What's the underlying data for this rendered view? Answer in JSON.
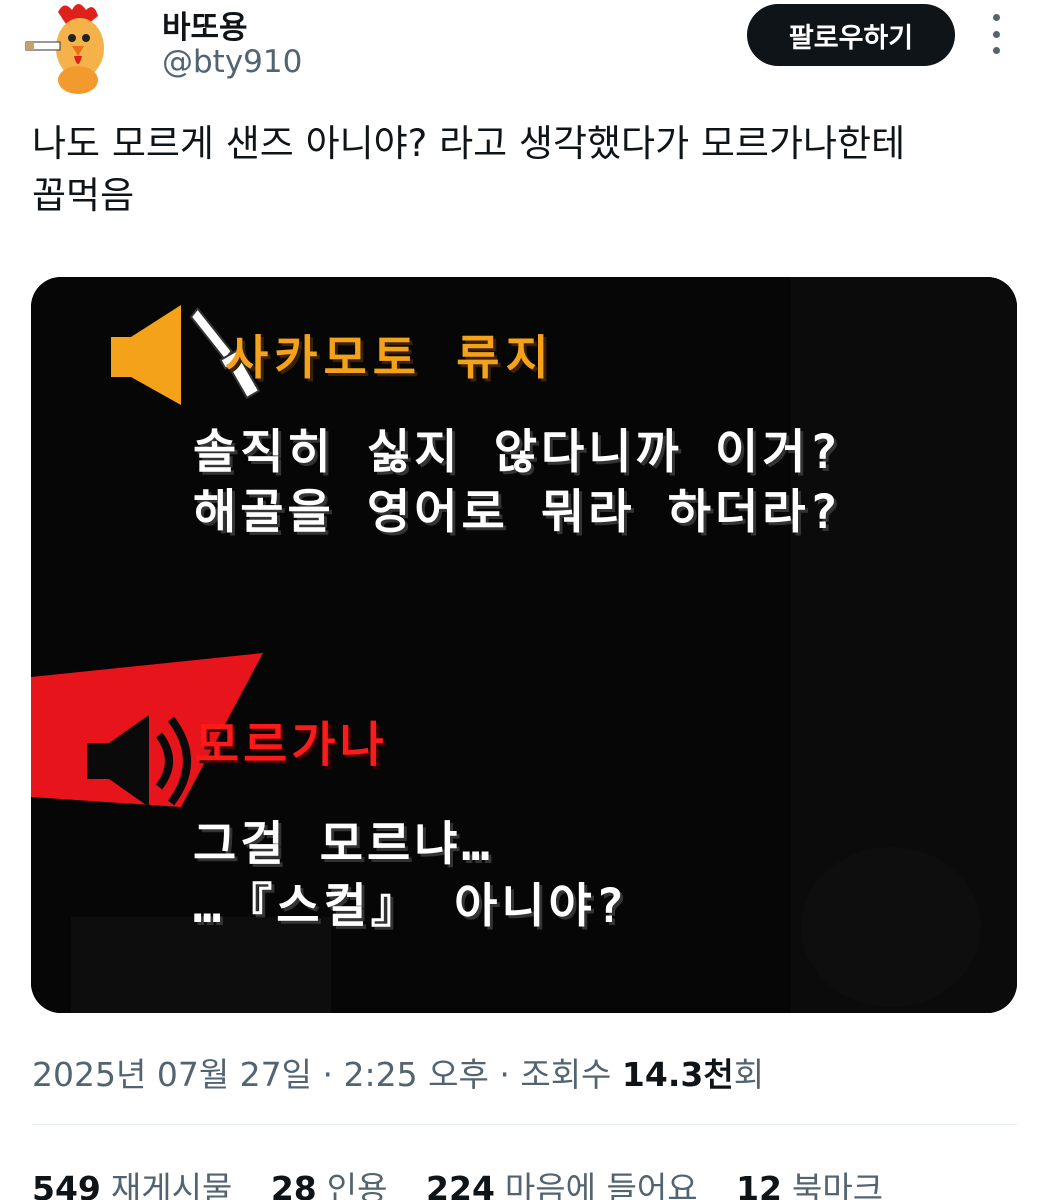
{
  "author": {
    "display_name": "바또용",
    "handle": "@bty910",
    "avatar_icon": "rooster-avatar"
  },
  "actions": {
    "follow_label": "팔로우하기",
    "more_icon": "more-vertical-icon"
  },
  "tweet": {
    "text": "나도 모르게 샌즈 아니야? 라고 생각했다가 모르가나한테\n꼽먹음"
  },
  "media": {
    "speaker1_name": "사카모토 류지",
    "speaker1_line1": "솔직히 싫지 않다니까 이거?",
    "speaker1_line2": "해골을 영어로 뭐라 하더라?",
    "speaker2_name": "모르가나",
    "speaker2_line1": "그걸 모르냐…",
    "speaker2_line2": "…『스컬』 아니야?",
    "colors": {
      "speaker1": "#f5a21b",
      "speaker2": "#ff1a1a",
      "dialogue": "#ffffff"
    }
  },
  "meta": {
    "date": "2025년 07월 27일",
    "time": "2:25 오후",
    "views_label": "조회수",
    "views_count": "14.3",
    "views_unit": "천",
    "views_suffix": "회"
  },
  "stats": {
    "retweets": "549",
    "retweets_label": "재게시물",
    "quotes": "28",
    "quotes_label": "인용",
    "likes": "224",
    "likes_label": "마음에 들어요",
    "bookmarks": "12",
    "bookmarks_label": "북마크"
  }
}
